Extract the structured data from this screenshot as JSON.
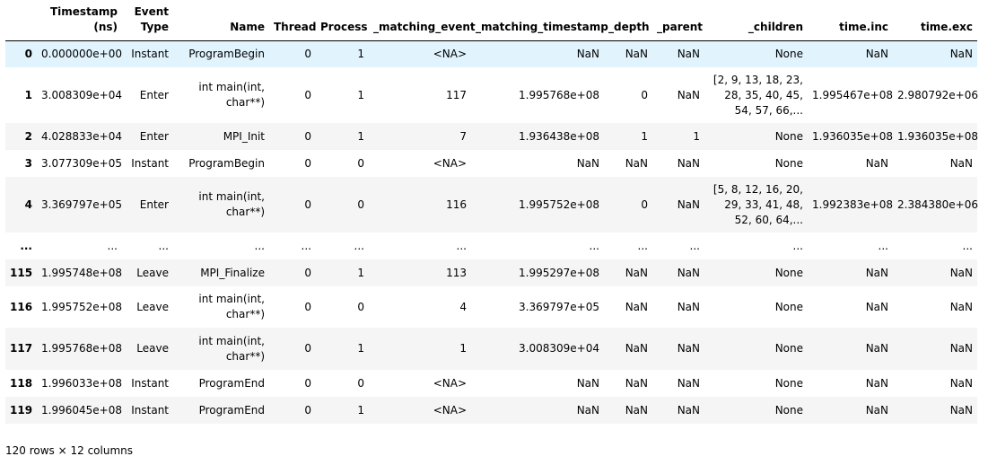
{
  "columns": {
    "timestamp": "Timestamp (ns)",
    "event_type": "Event Type",
    "name": "Name",
    "thread": "Thread",
    "process": "Process",
    "matching_event": "_matching_event",
    "matching_timestamp": "_matching_timestamp",
    "depth": "_depth",
    "parent": "_parent",
    "children": "_children",
    "time_inc": "time.inc",
    "time_exc": "time.exc"
  },
  "rows": [
    {
      "idx": "0",
      "timestamp": "0.000000e+00",
      "event_type": "Instant",
      "name": "ProgramBegin",
      "thread": "0",
      "process": "1",
      "matching_event": "<NA>",
      "matching_timestamp": "NaN",
      "depth": "NaN",
      "parent": "NaN",
      "children": "None",
      "time_inc": "NaN",
      "time_exc": "NaN"
    },
    {
      "idx": "1",
      "timestamp": "3.008309e+04",
      "event_type": "Enter",
      "name": "int main(int, char**)",
      "thread": "0",
      "process": "1",
      "matching_event": "117",
      "matching_timestamp": "1.995768e+08",
      "depth": "0",
      "parent": "NaN",
      "children": "[2, 9, 13, 18, 23, 28, 35, 40, 45, 54, 57, 66,...",
      "time_inc": "1.995467e+08",
      "time_exc": "2.980792e+06"
    },
    {
      "idx": "2",
      "timestamp": "4.028833e+04",
      "event_type": "Enter",
      "name": "MPI_Init",
      "thread": "0",
      "process": "1",
      "matching_event": "7",
      "matching_timestamp": "1.936438e+08",
      "depth": "1",
      "parent": "1",
      "children": "None",
      "time_inc": "1.936035e+08",
      "time_exc": "1.936035e+08"
    },
    {
      "idx": "3",
      "timestamp": "3.077309e+05",
      "event_type": "Instant",
      "name": "ProgramBegin",
      "thread": "0",
      "process": "0",
      "matching_event": "<NA>",
      "matching_timestamp": "NaN",
      "depth": "NaN",
      "parent": "NaN",
      "children": "None",
      "time_inc": "NaN",
      "time_exc": "NaN"
    },
    {
      "idx": "4",
      "timestamp": "3.369797e+05",
      "event_type": "Enter",
      "name": "int main(int, char**)",
      "thread": "0",
      "process": "0",
      "matching_event": "116",
      "matching_timestamp": "1.995752e+08",
      "depth": "0",
      "parent": "NaN",
      "children": "[5, 8, 12, 16, 20, 29, 33, 41, 48, 52, 60, 64,...",
      "time_inc": "1.992383e+08",
      "time_exc": "2.384380e+06"
    },
    {
      "idx": "...",
      "timestamp": "...",
      "event_type": "...",
      "name": "...",
      "thread": "...",
      "process": "...",
      "matching_event": "...",
      "matching_timestamp": "...",
      "depth": "...",
      "parent": "...",
      "children": "...",
      "time_inc": "...",
      "time_exc": "..."
    },
    {
      "idx": "115",
      "timestamp": "1.995748e+08",
      "event_type": "Leave",
      "name": "MPI_Finalize",
      "thread": "0",
      "process": "1",
      "matching_event": "113",
      "matching_timestamp": "1.995297e+08",
      "depth": "NaN",
      "parent": "NaN",
      "children": "None",
      "time_inc": "NaN",
      "time_exc": "NaN"
    },
    {
      "idx": "116",
      "timestamp": "1.995752e+08",
      "event_type": "Leave",
      "name": "int main(int, char**)",
      "thread": "0",
      "process": "0",
      "matching_event": "4",
      "matching_timestamp": "3.369797e+05",
      "depth": "NaN",
      "parent": "NaN",
      "children": "None",
      "time_inc": "NaN",
      "time_exc": "NaN"
    },
    {
      "idx": "117",
      "timestamp": "1.995768e+08",
      "event_type": "Leave",
      "name": "int main(int, char**)",
      "thread": "0",
      "process": "1",
      "matching_event": "1",
      "matching_timestamp": "3.008309e+04",
      "depth": "NaN",
      "parent": "NaN",
      "children": "None",
      "time_inc": "NaN",
      "time_exc": "NaN"
    },
    {
      "idx": "118",
      "timestamp": "1.996033e+08",
      "event_type": "Instant",
      "name": "ProgramEnd",
      "thread": "0",
      "process": "0",
      "matching_event": "<NA>",
      "matching_timestamp": "NaN",
      "depth": "NaN",
      "parent": "NaN",
      "children": "None",
      "time_inc": "NaN",
      "time_exc": "NaN"
    },
    {
      "idx": "119",
      "timestamp": "1.996045e+08",
      "event_type": "Instant",
      "name": "ProgramEnd",
      "thread": "0",
      "process": "1",
      "matching_event": "<NA>",
      "matching_timestamp": "NaN",
      "depth": "NaN",
      "parent": "NaN",
      "children": "None",
      "time_inc": "NaN",
      "time_exc": "NaN"
    }
  ],
  "footer": "120 rows × 12 columns",
  "colors": {
    "hover_row": "#e1f4fd",
    "striped_row": "#f5f5f5",
    "text": "#000000"
  }
}
